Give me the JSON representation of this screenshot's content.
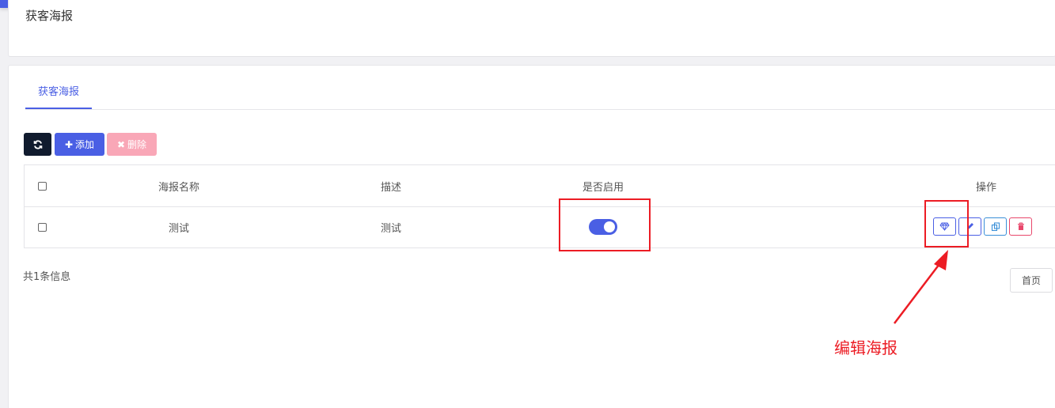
{
  "header": {
    "title": "获客海报"
  },
  "tabs": [
    {
      "label": "获客海报",
      "active": true
    }
  ],
  "toolbar": {
    "refresh_icon": "refresh-icon",
    "add_label": "添加",
    "delete_label": "删除"
  },
  "table": {
    "columns": [
      "海报名称",
      "描述",
      "是否启用",
      "操作"
    ],
    "rows": [
      {
        "name": "测试",
        "description": "测试",
        "enabled": true
      }
    ]
  },
  "actions": [
    {
      "icon": "diamond-icon",
      "color": "#4a5fe4"
    },
    {
      "icon": "pencil-icon",
      "color": "#4a5fe4"
    },
    {
      "icon": "copy-icon",
      "color": "#3a8fd8"
    },
    {
      "icon": "trash-icon",
      "color": "#e8476b"
    }
  ],
  "footer": {
    "summary": "共1条信息",
    "first_page": "首页"
  },
  "annotation": {
    "text": "编辑海报",
    "color": "#ec1c24"
  },
  "colors": {
    "primary": "#4a5fe4",
    "dark": "#101b2e",
    "danger_light": "#f9a7b7"
  }
}
